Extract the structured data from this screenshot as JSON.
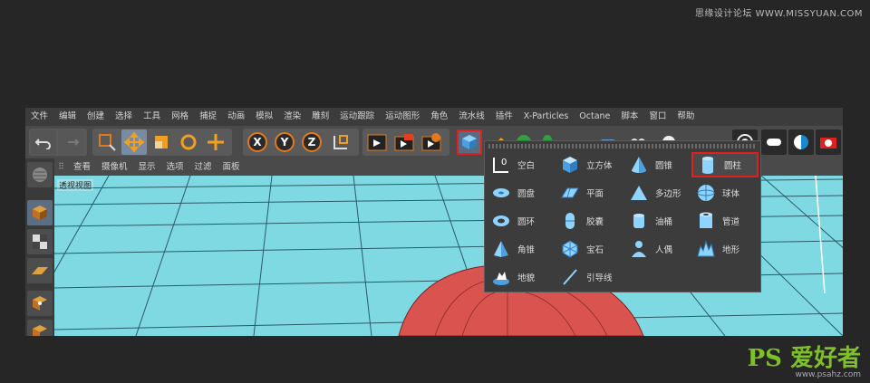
{
  "watermark_top": "思缘设计论坛 WWW.MISSYUAN.COM",
  "menu": [
    "文件",
    "编辑",
    "创建",
    "选择",
    "工具",
    "网格",
    "捕捉",
    "动画",
    "模拟",
    "渲染",
    "雕刻",
    "运动跟踪",
    "运动图形",
    "角色",
    "流水线",
    "插件",
    "X-Particles",
    "Octane",
    "脚本",
    "窗口",
    "帮助"
  ],
  "toolbar": {
    "axes": [
      "X",
      "Y",
      "Z"
    ],
    "accent": "#e07a20",
    "highlight": "#e02020"
  },
  "viewport_menu": [
    "查看",
    "摄像机",
    "显示",
    "选项",
    "过滤",
    "面板"
  ],
  "viewport_label": "透视视图",
  "viewport_color": "#7fd9e3",
  "popup_items": [
    {
      "label": "空白",
      "icon": "null-icon"
    },
    {
      "label": "圆盘",
      "icon": "disc-icon"
    },
    {
      "label": "圆环",
      "icon": "torus-icon"
    },
    {
      "label": "角锥",
      "icon": "pyramid-icon"
    },
    {
      "label": "地貌",
      "icon": "landscape-icon"
    },
    {
      "label": "立方体",
      "icon": "cube-icon"
    },
    {
      "label": "平面",
      "icon": "plane-icon"
    },
    {
      "label": "胶囊",
      "icon": "capsule-icon"
    },
    {
      "label": "宝石",
      "icon": "gem-icon"
    },
    {
      "label": "引导线",
      "icon": "guide-line-icon"
    },
    {
      "label": "圆锥",
      "icon": "cone-icon"
    },
    {
      "label": "多边形",
      "icon": "polygon-icon"
    },
    {
      "label": "油桶",
      "icon": "oiltank-icon"
    },
    {
      "label": "人偶",
      "icon": "figure-icon"
    },
    {
      "label": "圆柱",
      "icon": "cylinder-icon"
    },
    {
      "label": "球体",
      "icon": "sphere-icon"
    },
    {
      "label": "管道",
      "icon": "tube-icon"
    },
    {
      "label": "地形",
      "icon": "relief-icon"
    }
  ],
  "watermark_logo": {
    "big": "PS 爱好者",
    "small": "www.psahz.com"
  }
}
